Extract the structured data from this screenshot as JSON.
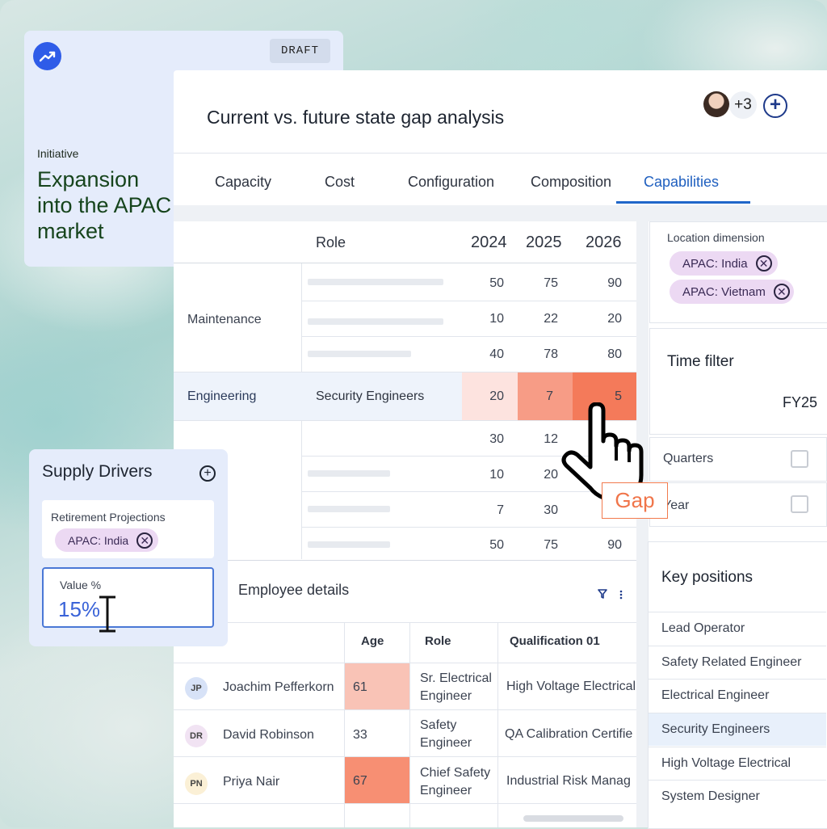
{
  "initiative": {
    "badge": "DRAFT",
    "label": "Initiative",
    "title": "Expansion into the APAC market",
    "icon": "trending-up-icon"
  },
  "header": {
    "title": "Current vs. future state gap analysis",
    "collaborators_more": "+3"
  },
  "tabs": [
    {
      "label": "Capacity"
    },
    {
      "label": "Cost"
    },
    {
      "label": "Configuration"
    },
    {
      "label": "Composition"
    },
    {
      "label": "Capabilities",
      "active": true
    }
  ],
  "capabilities_table": {
    "columns": {
      "role": "Role",
      "years": [
        "2024",
        "2025",
        "2026"
      ]
    },
    "groups": {
      "maintenance": "Maintenance",
      "engineering": "Engineering"
    },
    "rows": [
      {
        "role": "",
        "values": [
          "50",
          "75",
          "90"
        ]
      },
      {
        "role": "",
        "values": [
          "10",
          "22",
          "20"
        ]
      },
      {
        "role": "",
        "values": [
          "40",
          "78",
          "80"
        ]
      },
      {
        "role": "Security Engineers",
        "values": [
          "20",
          "7",
          "5"
        ]
      },
      {
        "role": "",
        "values": [
          "30",
          "12",
          ""
        ]
      },
      {
        "role": "",
        "values": [
          "10",
          "20",
          ""
        ]
      },
      {
        "role": "",
        "values": [
          "7",
          "30",
          ""
        ]
      },
      {
        "role": "",
        "values": [
          "50",
          "75",
          "90"
        ]
      }
    ],
    "heat_colors": [
      "#fde3df",
      "#f79c86",
      "#f47a5a"
    ]
  },
  "gap_callout": "Gap",
  "location": {
    "label": "Location dimension",
    "chips": [
      "APAC: India",
      "APAC: Vietnam"
    ]
  },
  "time_filter": {
    "title": "Time filter",
    "value": "FY25",
    "options": [
      {
        "label": "Quarters",
        "checked": false
      },
      {
        "label": "Year",
        "checked": false
      }
    ]
  },
  "key_positions": {
    "title": "Key positions",
    "items": [
      "Lead Operator",
      "Safety Related Engineer",
      "Electrical Engineer",
      "Security Engineers",
      "High Voltage Electrical",
      "System Designer"
    ],
    "selected_index": 3
  },
  "supply_drivers": {
    "title": "Supply Drivers",
    "retirement": {
      "label": "Retirement Projections",
      "chip": "APAC: India"
    },
    "value": {
      "label": "Value %",
      "input": "15%"
    }
  },
  "employee_details": {
    "title": "Employee details",
    "columns": [
      "Age",
      "Role",
      "Qualification 01"
    ],
    "rows": [
      {
        "initials": "JP",
        "name": "Joachim Pefferkorn",
        "age": "61",
        "role": "Sr. Electrical Engineer",
        "qualification": "High Voltage Electrical",
        "avatar_color": "#d7e2f7",
        "age_color": "#f9c3b6"
      },
      {
        "initials": "DR",
        "name": "David Robinson",
        "age": "33",
        "role": "Safety Engineer",
        "qualification": "QA Calibration Certifie",
        "avatar_color": "#f1e3f3",
        "age_color": "#ffffff"
      },
      {
        "initials": "PN",
        "name": "Priya Nair",
        "age": "67",
        "role": "Chief Safety Engineer",
        "qualification": "Industrial Risk Manag",
        "avatar_color": "#fbf0d6",
        "age_color": "#f78f73"
      }
    ]
  }
}
